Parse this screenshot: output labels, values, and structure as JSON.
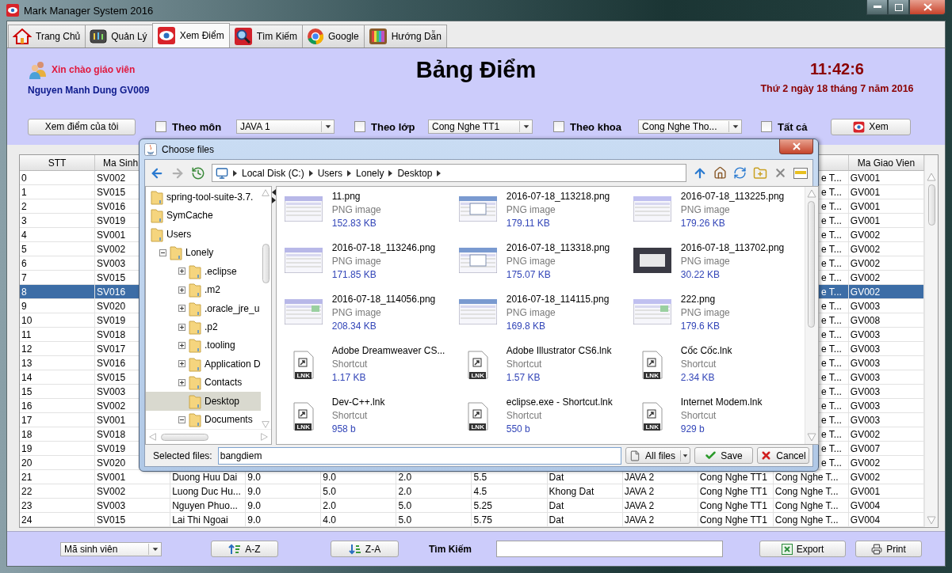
{
  "window": {
    "title": "Mark Manager System 2016"
  },
  "tabs": [
    {
      "label": "Trang Chủ",
      "kind": "home",
      "selected": false
    },
    {
      "label": "Quản Lý",
      "kind": "manage",
      "selected": false
    },
    {
      "label": "Xem Điểm",
      "kind": "view",
      "selected": true
    },
    {
      "label": "Tìm Kiếm",
      "kind": "search",
      "selected": false
    },
    {
      "label": "Google",
      "kind": "google",
      "selected": false
    },
    {
      "label": "Hướng Dẫn",
      "kind": "guide",
      "selected": false
    }
  ],
  "header": {
    "greeting": "Xin chào giáo viên",
    "teacher": "Nguyen Manh Dung GV009",
    "title": "Bảng Điểm",
    "time": "11:42:6",
    "date": "Thứ 2 ngày 18 tháng 7 năm 2016"
  },
  "filters": {
    "my_marks_button": "Xem điểm của tôi",
    "options": [
      {
        "label": "Theo môn",
        "checked": false,
        "value": "JAVA 1"
      },
      {
        "label": "Theo lớp",
        "checked": false,
        "value": "Cong Nghe TT1"
      },
      {
        "label": "Theo khoa",
        "checked": false,
        "value": "Cong Nghe Tho..."
      },
      {
        "label": "Tất cả",
        "checked": false
      }
    ],
    "view_button": "Xem"
  },
  "table": {
    "columns": [
      {
        "label": "STT"
      },
      {
        "label": "Ma Sinh"
      },
      null,
      null,
      null,
      null,
      null,
      null,
      null,
      null,
      null,
      {
        "label": "Ma Giao Vien"
      }
    ],
    "rows": [
      {
        "kind": "covered",
        "selected": false,
        "cells": [
          "0",
          "SV002",
          "e T...",
          "GV001"
        ]
      },
      {
        "kind": "covered",
        "selected": false,
        "cells": [
          "1",
          "SV015",
          "e T...",
          "GV001"
        ]
      },
      {
        "kind": "covered",
        "selected": false,
        "cells": [
          "2",
          "SV016",
          "e T...",
          "GV001"
        ]
      },
      {
        "kind": "covered",
        "selected": false,
        "cells": [
          "3",
          "SV019",
          "e T...",
          "GV001"
        ]
      },
      {
        "kind": "covered",
        "selected": false,
        "cells": [
          "4",
          "SV001",
          "e T...",
          "GV002"
        ]
      },
      {
        "kind": "covered",
        "selected": false,
        "cells": [
          "5",
          "SV002",
          "e T...",
          "GV002"
        ]
      },
      {
        "kind": "covered",
        "selected": false,
        "cells": [
          "6",
          "SV003",
          "e T...",
          "GV002"
        ]
      },
      {
        "kind": "covered",
        "selected": false,
        "cells": [
          "7",
          "SV015",
          "e T...",
          "GV002"
        ]
      },
      {
        "kind": "covered",
        "selected": true,
        "cells": [
          "8",
          "SV016",
          "e T...",
          "GV002"
        ]
      },
      {
        "kind": "covered",
        "selected": false,
        "cells": [
          "9",
          "SV020",
          "e T...",
          "GV003"
        ]
      },
      {
        "kind": "covered",
        "selected": false,
        "cells": [
          "10",
          "SV019",
          "e T...",
          "GV008"
        ]
      },
      {
        "kind": "covered",
        "selected": false,
        "cells": [
          "11",
          "SV018",
          "e T...",
          "GV003"
        ]
      },
      {
        "kind": "covered",
        "selected": false,
        "cells": [
          "12",
          "SV017",
          "e T...",
          "GV003"
        ]
      },
      {
        "kind": "covered",
        "selected": false,
        "cells": [
          "13",
          "SV016",
          "e T...",
          "GV003"
        ]
      },
      {
        "kind": "covered",
        "selected": false,
        "cells": [
          "14",
          "SV015",
          "e T...",
          "GV003"
        ]
      },
      {
        "kind": "covered",
        "selected": false,
        "cells": [
          "15",
          "SV003",
          "e T...",
          "GV003"
        ]
      },
      {
        "kind": "covered",
        "selected": false,
        "cells": [
          "16",
          "SV002",
          "e T...",
          "GV003"
        ]
      },
      {
        "kind": "covered",
        "selected": false,
        "cells": [
          "17",
          "SV001",
          "e T...",
          "GV003"
        ]
      },
      {
        "kind": "covered",
        "selected": false,
        "cells": [
          "18",
          "SV018",
          "e T...",
          "GV002"
        ]
      },
      {
        "kind": "covered",
        "selected": false,
        "cells": [
          "19",
          "SV019",
          "e T...",
          "GV007"
        ]
      },
      {
        "kind": "covered",
        "selected": false,
        "cells": [
          "20",
          "SV020",
          "e T...",
          "GV002"
        ]
      },
      {
        "kind": "full",
        "selected": false,
        "cells": [
          "21",
          "SV001",
          "Duong Huu Dai",
          "9.0",
          "9.0",
          "2.0",
          "5.5",
          "Dat",
          "JAVA 2",
          "Cong Nghe TT1",
          "Cong Nghe T...",
          "GV002"
        ]
      },
      {
        "kind": "full",
        "selected": false,
        "cells": [
          "22",
          "SV002",
          "Luong Duc Hu...",
          "9.0",
          "5.0",
          "2.0",
          "4.5",
          "Khong Dat",
          "JAVA 2",
          "Cong Nghe TT1",
          "Cong Nghe T...",
          "GV001"
        ]
      },
      {
        "kind": "full",
        "selected": false,
        "cells": [
          "23",
          "SV003",
          "Nguyen Phuo...",
          "9.0",
          "2.0",
          "5.0",
          "5.25",
          "Dat",
          "JAVA 2",
          "Cong Nghe TT1",
          "Cong Nghe T...",
          "GV004"
        ]
      },
      {
        "kind": "full",
        "selected": false,
        "cells": [
          "24",
          "SV015",
          "Lai Thi Ngoai",
          "9.0",
          "4.0",
          "5.0",
          "5.75",
          "Dat",
          "JAVA 2",
          "Cong Nghe TT1",
          "Cong Nghe T...",
          "GV004"
        ]
      }
    ]
  },
  "dialog": {
    "title": "Choose files",
    "path": [
      "Local Disk (C:)",
      "Users",
      "Lonely",
      "Desktop"
    ],
    "tree": [
      {
        "label": "spring-tool-suite-3.7.",
        "selected": false
      },
      {
        "label": "SymCache",
        "selected": false
      },
      {
        "label": "Users",
        "selected": false,
        "children": [
          {
            "label": "Lonely",
            "expanded": true,
            "selected": false,
            "children": [
              {
                "label": ".eclipse",
                "expanded": false,
                "selected": false
              },
              {
                "label": ".m2",
                "expanded": false,
                "selected": false
              },
              {
                "label": ".oracle_jre_u",
                "expanded": false,
                "selected": false
              },
              {
                "label": ".p2",
                "expanded": false,
                "selected": false
              },
              {
                "label": ".tooling",
                "expanded": false,
                "selected": false
              },
              {
                "label": "Application D",
                "expanded": false,
                "selected": false
              },
              {
                "label": "Contacts",
                "expanded": false,
                "selected": false
              },
              {
                "label": "Desktop",
                "selected": true
              },
              {
                "label": "Documents",
                "expanded": true,
                "selected": false
              }
            ]
          }
        ]
      }
    ],
    "files": [
      {
        "name": "11.png",
        "type": "PNG image",
        "size": "152.83 KB"
      },
      {
        "name": "2016-07-18_113218.png",
        "type": "PNG image",
        "size": "179.11 KB"
      },
      {
        "name": "2016-07-18_113225.png",
        "type": "PNG image",
        "size": "179.26 KB"
      },
      {
        "name": "2016-07-18_113246.png",
        "type": "PNG image",
        "size": "171.85 KB"
      },
      {
        "name": "2016-07-18_113318.png",
        "type": "PNG image",
        "size": "175.07 KB"
      },
      {
        "name": "2016-07-18_113702.png",
        "type": "PNG image",
        "size": "30.22 KB"
      },
      {
        "name": "2016-07-18_114056.png",
        "type": "PNG image",
        "size": "208.34 KB"
      },
      {
        "name": "2016-07-18_114115.png",
        "type": "PNG image",
        "size": "169.8 KB"
      },
      {
        "name": "222.png",
        "type": "PNG image",
        "size": "179.6 KB"
      },
      {
        "kind": "shortcut",
        "icon_label": "LNK",
        "name": "Adobe Dreamweaver CS...",
        "type": "Shortcut",
        "size": "1.17 KB"
      },
      {
        "kind": "shortcut",
        "icon_label": "LNK",
        "name": "Adobe Illustrator CS6.lnk",
        "type": "Shortcut",
        "size": "1.57 KB"
      },
      {
        "kind": "shortcut",
        "icon_label": "LNK",
        "name": "Cốc Cốc.lnk",
        "type": "Shortcut",
        "size": "2.34 KB"
      },
      {
        "kind": "shortcut",
        "icon_label": "LNK",
        "name": "Dev-C++.lnk",
        "type": "Shortcut",
        "size": "958 b"
      },
      {
        "kind": "shortcut",
        "icon_label": "LNK",
        "name": "eclipse.exe - Shortcut.lnk",
        "type": "Shortcut",
        "size": "550 b"
      },
      {
        "kind": "shortcut",
        "icon_label": "LNK",
        "name": "Internet Modem.lnk",
        "type": "Shortcut",
        "size": "929 b"
      }
    ],
    "selected_label": "Selected files:",
    "selected_value": "bangdiem",
    "filter": "All files",
    "save": "Save",
    "cancel": "Cancel"
  },
  "bottom_bar": {
    "sort_field": "Mã sinh viên",
    "sort_asc": "A-Z",
    "sort_desc": "Z-A",
    "search_label": "Tìm Kiếm",
    "export": "Export",
    "print": "Print"
  }
}
